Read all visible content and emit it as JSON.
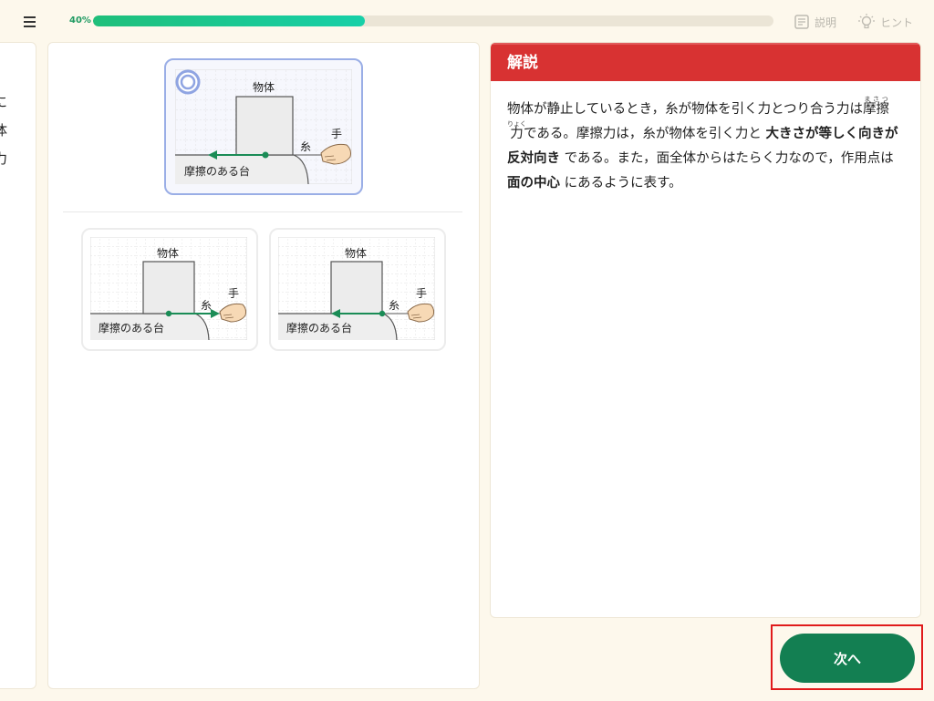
{
  "progress": {
    "label": "40%",
    "value": 0.4
  },
  "toolbar": {
    "explain_label": "説明",
    "hint_label": "ヒント"
  },
  "left_panel": {
    "chars": [
      "に",
      "体",
      "力"
    ]
  },
  "diagram": {
    "object": "物体",
    "string": "糸",
    "hand": "手",
    "table": "摩擦のある台"
  },
  "explanation": {
    "title": "解説",
    "p1": "物体が静止しているとき，糸が物体を引く力とつり合う力は",
    "ruby_1_base": "摩擦",
    "ruby_1_text": "まさつ",
    "ruby_2_base": "力",
    "ruby_2_text": "りょく",
    "p2": "である。摩擦力は，糸が物体を引く力と",
    "bold1": "大きさが等しく向きが反対向き",
    "p3": "である。また，面全体からはたらく力なので，作用点は",
    "bold2": "面の中心",
    "p4": "にあるように表す。"
  },
  "next_button": {
    "label": "次へ"
  },
  "colors": {
    "accent_green": "#137f52",
    "header_red": "#d83232",
    "arrow_green": "#1a8c56",
    "highlight_border": "#e01b1b"
  }
}
